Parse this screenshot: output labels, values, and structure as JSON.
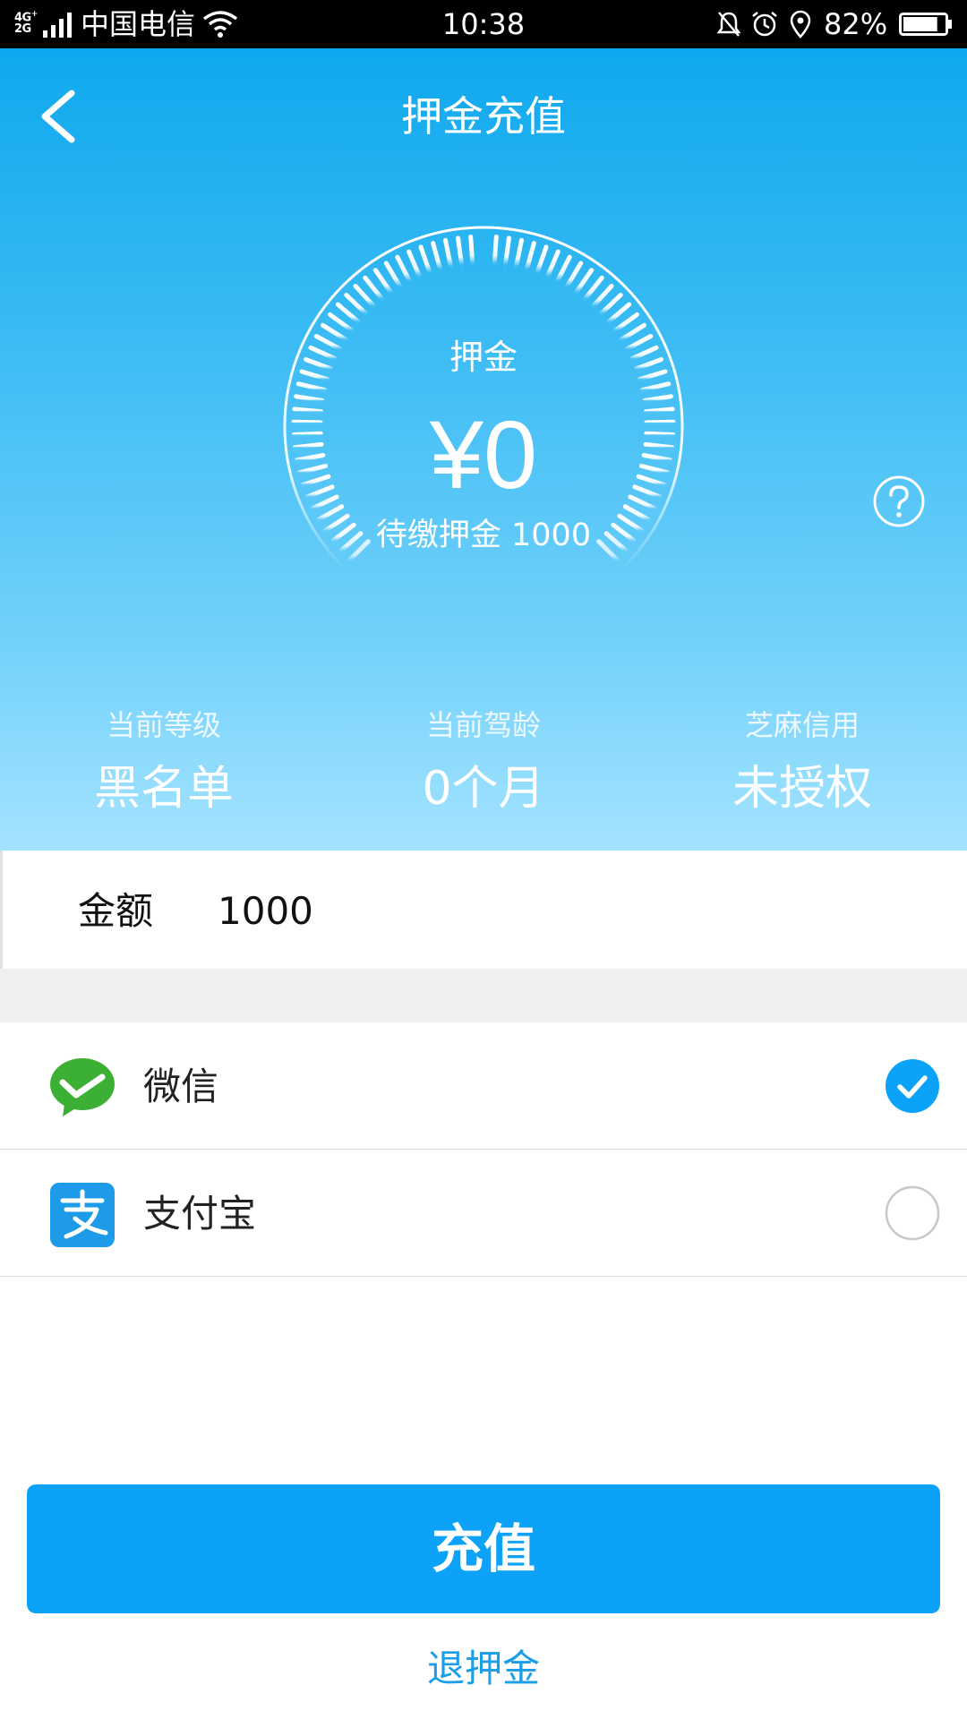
{
  "status_bar": {
    "network": "4G+\n2G",
    "carrier": "中国电信",
    "time": "10:38",
    "battery": "82%",
    "battery_level": 0.82,
    "icons": [
      "signal-icon",
      "wifi-icon",
      "mute-bell-icon",
      "alarm-icon",
      "location-icon",
      "battery-icon"
    ]
  },
  "header": {
    "back_icon": "chevron-left-icon",
    "title": "押金充值"
  },
  "deposit": {
    "label": "押金",
    "amount": "¥0",
    "pending": "待缴押金 1000"
  },
  "help_icon": "question-circle-icon",
  "stats": [
    {
      "label": "当前等级",
      "value": "黑名单"
    },
    {
      "label": "当前驾龄",
      "value": "0个月"
    },
    {
      "label": "芝麻信用",
      "value": "未授权"
    }
  ],
  "amount": {
    "label": "金额",
    "value": "1000"
  },
  "payment_methods": [
    {
      "name": "微信",
      "icon": "wechat-icon",
      "selected": true
    },
    {
      "name": "支付宝",
      "icon": "alipay-icon",
      "selected": false
    }
  ],
  "actions": {
    "recharge": "充值",
    "refund": "退押金"
  },
  "colors": {
    "primary": "#0ba2f7",
    "hero_top": "#0fa8ee",
    "hero_bottom": "#a4e3ff",
    "wechat_green": "#3cb034",
    "alipay_blue": "#1e9be8",
    "link": "#1a9ee8"
  }
}
